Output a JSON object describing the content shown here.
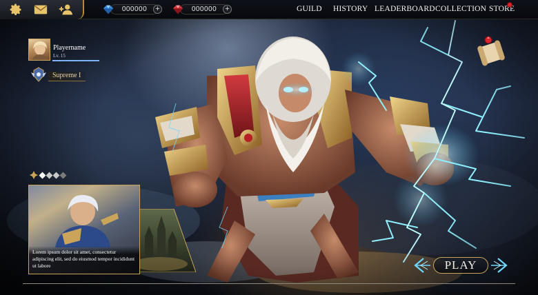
{
  "header": {
    "icons": [
      "gear-icon",
      "mail-icon",
      "add-friend-icon"
    ],
    "currencies": [
      {
        "icon": "blue-gem-icon",
        "amount": "000000",
        "plus": "+"
      },
      {
        "icon": "red-gem-icon",
        "amount": "000000",
        "plus": "+"
      }
    ],
    "nav": [
      "GUILD",
      "HISTORY",
      "LEADERBOARD",
      "COLLECTION",
      "STORE"
    ],
    "store_notification": true
  },
  "player": {
    "name": "Playername",
    "level": "Lv. 15",
    "rank": "Supreme I"
  },
  "news": {
    "text": "Lorem ipsum dolor sit amet, consectetur adipiscing elit, sed do eiusmod tempor incididunt ut labore",
    "pages": 4,
    "active_page": 1
  },
  "play": {
    "label": "PLAY"
  },
  "colors": {
    "gold": "#c9a45a",
    "lightning": "#7fe3ff",
    "notification": "#d8242a",
    "xp": "#7fb4ff"
  }
}
